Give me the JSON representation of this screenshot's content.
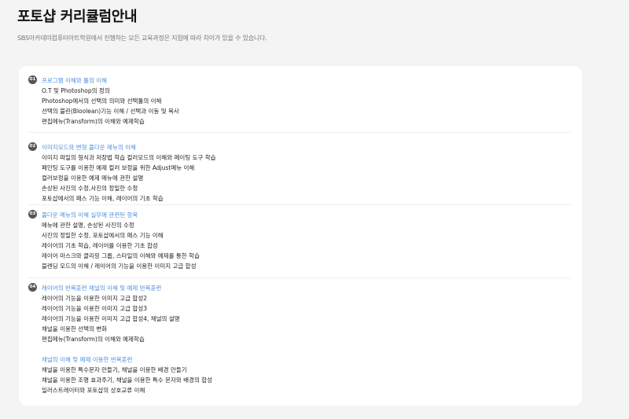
{
  "header": {
    "title": "포토샵 커리큘럼안내",
    "subtitle": "SBS아카데미컴퓨터아트학원에서 진행하는 모든 교육과정은 지점에 따라 차이가 있을 수 있습니다."
  },
  "sections": [
    {
      "number": "01",
      "title": "프로그램 이해와 툴의 이해",
      "items": [
        "O.T 및 Photoshop의 정의",
        "Photoshop에서의 선택의 의미와 선택툴의 이해",
        "선택의 불린(Bloolean)기능 이해 / 선택과 이동 및 복사",
        "편집메뉴(Transform)의 이해와 예제학습"
      ]
    },
    {
      "number": "02",
      "title": "이미지모드와 변형 풀다운 메뉴의 이해",
      "items": [
        "이미지 파일의 형식과 저장법 학습 컬러모드의 이해와 페이팅 도구 학습",
        "페인팅 도구를 이용한 예제 컬러 보정을 위한 Adjust메뉴 이해",
        "컬러보정을 이용한 예제 메뉴에 관한 설명",
        "손상된 사진의 수정,사진의 정밀한 수정",
        "포토샵에서의 패스 기능 이해, 레이어의 기초 학습"
      ]
    },
    {
      "number": "03",
      "title": "풀다운 메뉴의 이해 실무에 관련된 항목",
      "items": [
        "메뉴에 관한 설명, 손상된 사진의 수정",
        "사진의 정밀한 수정, 포토샵에서의 패스 기능 이해",
        "레이어의 기초 학습, 레이어를 이용한 기초 합성",
        "레이어 마스크와 클리핑 그룹, 스타일의 이해와 예제를 통한 학습",
        "블렌딩 모드의 이해 / 레이어의 기능을 이용한 이미지 고급 합성"
      ]
    },
    {
      "number": "04",
      "title": "레이어의 반복훈련 채널의 이해 및 예제 반복훈련",
      "items": [
        "레이어의 기능을 이용한 이미지 고급 합성2",
        "레이어의 기능을 이용한 이미지 고급 합성3",
        "레이어의 기능을 이용한 이미지 고급 합성4, 채널의 설명",
        "채널을 이용한 선택의 변화",
        "편집메뉴(Transform)의 이해와 예제학습"
      ],
      "subtitle": "채널의 이해 및 예제 이용한 반복훈련",
      "sub_items": [
        "채널을 이용한 특수문자 만들기, 채널을 이용한 배경 만들기",
        "채널을 이용한 조명 효과주기, 채널을 이용한 특수 문자와 배경의 합성",
        "일러스트레이터와 포토샵의 상호교류 이해"
      ]
    }
  ]
}
